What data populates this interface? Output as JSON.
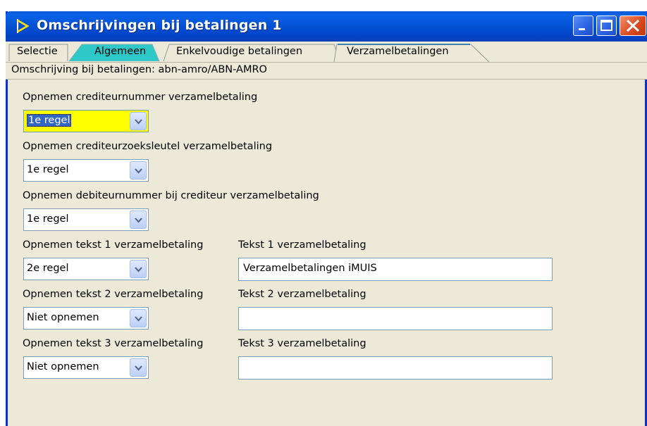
{
  "window": {
    "title": "Omschrijvingen bij betalingen 1"
  },
  "tabs": [
    {
      "label": "Selectie"
    },
    {
      "label": "Algemeen"
    },
    {
      "label": "Enkelvoudige betalingen"
    },
    {
      "label": "Verzamelbetalingen",
      "active": true
    }
  ],
  "info": {
    "text": "Omschrijving bij betalingen: abn-amro/ABN-AMRO"
  },
  "fields": {
    "crediteurnummer": {
      "label": "Opnemen crediteurnummer verzamelbetaling",
      "value": "1e regel"
    },
    "zoeksleutel": {
      "label": "Opnemen crediteurzoeksleutel verzamelbetaling",
      "value": "1e regel"
    },
    "debiteurnummer": {
      "label": "Opnemen debiteurnummer bij crediteur verzamelbetaling",
      "value": "1e regel"
    },
    "tekst1": {
      "label": "Opnemen tekst 1 verzamelbetaling",
      "value": "2e regel",
      "text_label": "Tekst 1 verzamelbetaling",
      "text_value": "Verzamelbetalingen iMUIS"
    },
    "tekst2": {
      "label": "Opnemen tekst 2 verzamelbetaling",
      "value": "Niet opnemen",
      "text_label": "Tekst 2 verzamelbetaling",
      "text_value": ""
    },
    "tekst3": {
      "label": "Opnemen tekst 3 verzamelbetaling",
      "value": "Niet opnemen",
      "text_label": "Tekst 3 verzamelbetaling",
      "text_value": ""
    }
  },
  "colors": {
    "titlebar": "#0553d6",
    "active_combo": "#ffff00",
    "algemeen_tab": "#2ec8c8",
    "background": "#ece9d8"
  }
}
